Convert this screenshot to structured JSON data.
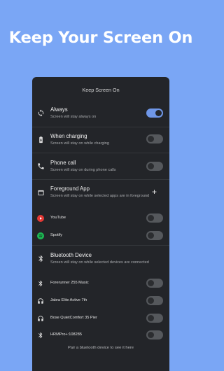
{
  "headline": "Keep Your Screen On",
  "screen_title": "Keep Screen On",
  "settings": [
    {
      "title": "Always",
      "subtitle": "Screen will stay always on",
      "icon": "sync-icon",
      "enabled": true
    },
    {
      "title": "When charging",
      "subtitle": "Screen will stay on while charging",
      "icon": "battery-charging-icon",
      "enabled": false
    },
    {
      "title": "Phone call",
      "subtitle": "Screen will stay on during phone calls",
      "icon": "phone-icon",
      "enabled": false
    }
  ],
  "foreground": {
    "title": "Foreground App",
    "subtitle": "Screen will stay on while selected apps are in foreground",
    "icon": "window-icon",
    "add_icon": "plus-icon",
    "apps": [
      {
        "name": "YouTube",
        "icon": "youtube-icon",
        "color": "#e53935",
        "enabled": false
      },
      {
        "name": "Spotify",
        "icon": "spotify-icon",
        "color": "#1db954",
        "enabled": false
      }
    ]
  },
  "bluetooth": {
    "title": "Bluetooth Device",
    "subtitle": "Screen will stay on while selected devices are connected",
    "icon": "bluetooth-icon",
    "devices": [
      {
        "name": "Forerunner 255 Music",
        "icon": "bluetooth-icon",
        "enabled": false
      },
      {
        "name": "Jabra Elite Active 7th",
        "icon": "headphones-icon",
        "enabled": false
      },
      {
        "name": "Bose QuietComfort 35 Pier",
        "icon": "headphones-icon",
        "enabled": false
      },
      {
        "name": "HRMPro+:108285",
        "icon": "bluetooth-icon",
        "enabled": false
      }
    ],
    "footer": "Pair a bluetooth device to see it here"
  },
  "colors": {
    "accent": "#6f97e8",
    "background": "#7aa6f5",
    "panel": "#232529"
  }
}
